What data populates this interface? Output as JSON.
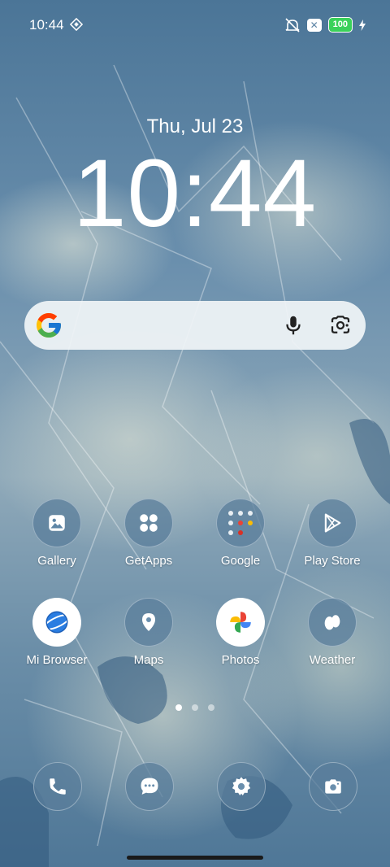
{
  "status_bar": {
    "time": "10:44",
    "battery": "100"
  },
  "clock": {
    "date": "Thu, Jul 23",
    "time": "10:44"
  },
  "search": {
    "provider": "Google"
  },
  "apps": [
    {
      "label": "Gallery",
      "icon": "gallery-icon"
    },
    {
      "label": "GetApps",
      "icon": "getapps-icon"
    },
    {
      "label": "Google",
      "icon": "google-folder-icon"
    },
    {
      "label": "Play Store",
      "icon": "play-store-icon"
    },
    {
      "label": "Mi Browser",
      "icon": "browser-icon"
    },
    {
      "label": "Maps",
      "icon": "maps-icon"
    },
    {
      "label": "Photos",
      "icon": "photos-icon"
    },
    {
      "label": "Weather",
      "icon": "weather-icon"
    }
  ],
  "dock": [
    "phone-icon",
    "messages-icon",
    "settings-icon",
    "camera-icon"
  ],
  "page_indicator": {
    "pages": 3,
    "current": 1
  }
}
